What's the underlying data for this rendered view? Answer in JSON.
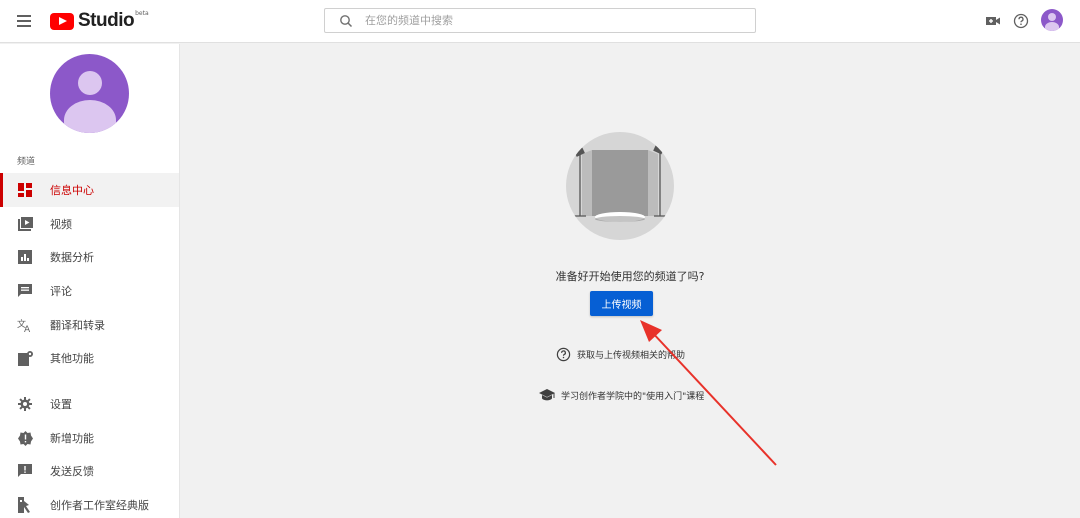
{
  "header": {
    "logo_text": "Studio",
    "logo_badge": "beta",
    "search_placeholder": "在您的频道中搜索",
    "icons": [
      "menu-icon",
      "create-video-icon",
      "help-icon",
      "account-avatar"
    ]
  },
  "sidebar": {
    "section_label": "频道",
    "items": [
      {
        "label": "信息中心",
        "icon": "dashboard-icon",
        "active": true
      },
      {
        "label": "视频",
        "icon": "videos-icon",
        "active": false
      },
      {
        "label": "数据分析",
        "icon": "analytics-icon",
        "active": false
      },
      {
        "label": "评论",
        "icon": "comments-icon",
        "active": false
      },
      {
        "label": "翻译和转录",
        "icon": "translate-icon",
        "active": false
      },
      {
        "label": "其他功能",
        "icon": "other-features-icon",
        "active": false
      },
      {
        "label": "设置",
        "icon": "settings-icon",
        "active": false
      },
      {
        "label": "新增功能",
        "icon": "whats-new-icon",
        "active": false
      },
      {
        "label": "发送反馈",
        "icon": "feedback-icon",
        "active": false
      },
      {
        "label": "创作者工作室经典版",
        "icon": "classic-studio-icon",
        "active": false
      }
    ]
  },
  "main": {
    "prompt": "准备好开始使用您的频道了吗?",
    "upload_button": "上传视频",
    "help_link": "获取与上传视频相关的帮助",
    "academy_link": "学习创作者学院中的\"使用入门\"课程"
  },
  "colors": {
    "accent_red": "#cc0000",
    "upload_blue": "#065fd4",
    "avatar_purple": "#8c58c9",
    "annotation_arrow": "#e8322a"
  }
}
